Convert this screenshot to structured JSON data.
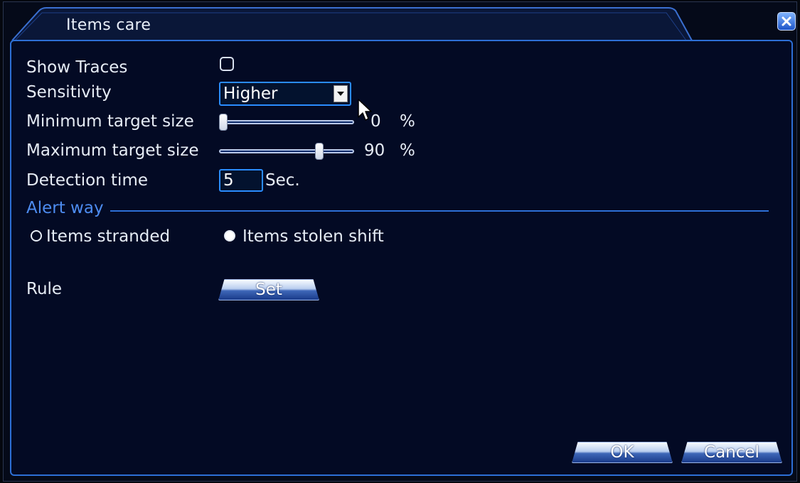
{
  "window": {
    "title": "Items care"
  },
  "form": {
    "show_traces": {
      "label": "Show Traces",
      "checked": false
    },
    "sensitivity": {
      "label": "Sensitivity",
      "value": "Higher"
    },
    "min_target": {
      "label": "Minimum target size",
      "value": "0",
      "unit": "%",
      "level": 0
    },
    "max_target": {
      "label": "Maximum target size",
      "value": "90",
      "unit": "%",
      "level": 0.9
    },
    "detection_time": {
      "label": "Detection time",
      "value": "5",
      "unit": "Sec."
    }
  },
  "alert": {
    "title": "Alert way",
    "options": [
      {
        "label": "Items stranded",
        "selected": false
      },
      {
        "label": "Items stolen shift",
        "selected": true
      }
    ]
  },
  "rule": {
    "label": "Rule",
    "button": "Set"
  },
  "footer": {
    "ok": "OK",
    "cancel": "Cancel"
  },
  "colors": {
    "accent": "#2d6fd6",
    "background": "#030a24"
  },
  "icons": {
    "close": "close-icon",
    "dropdown": "chevron-down-icon",
    "pointer": "mouse-cursor-icon"
  }
}
